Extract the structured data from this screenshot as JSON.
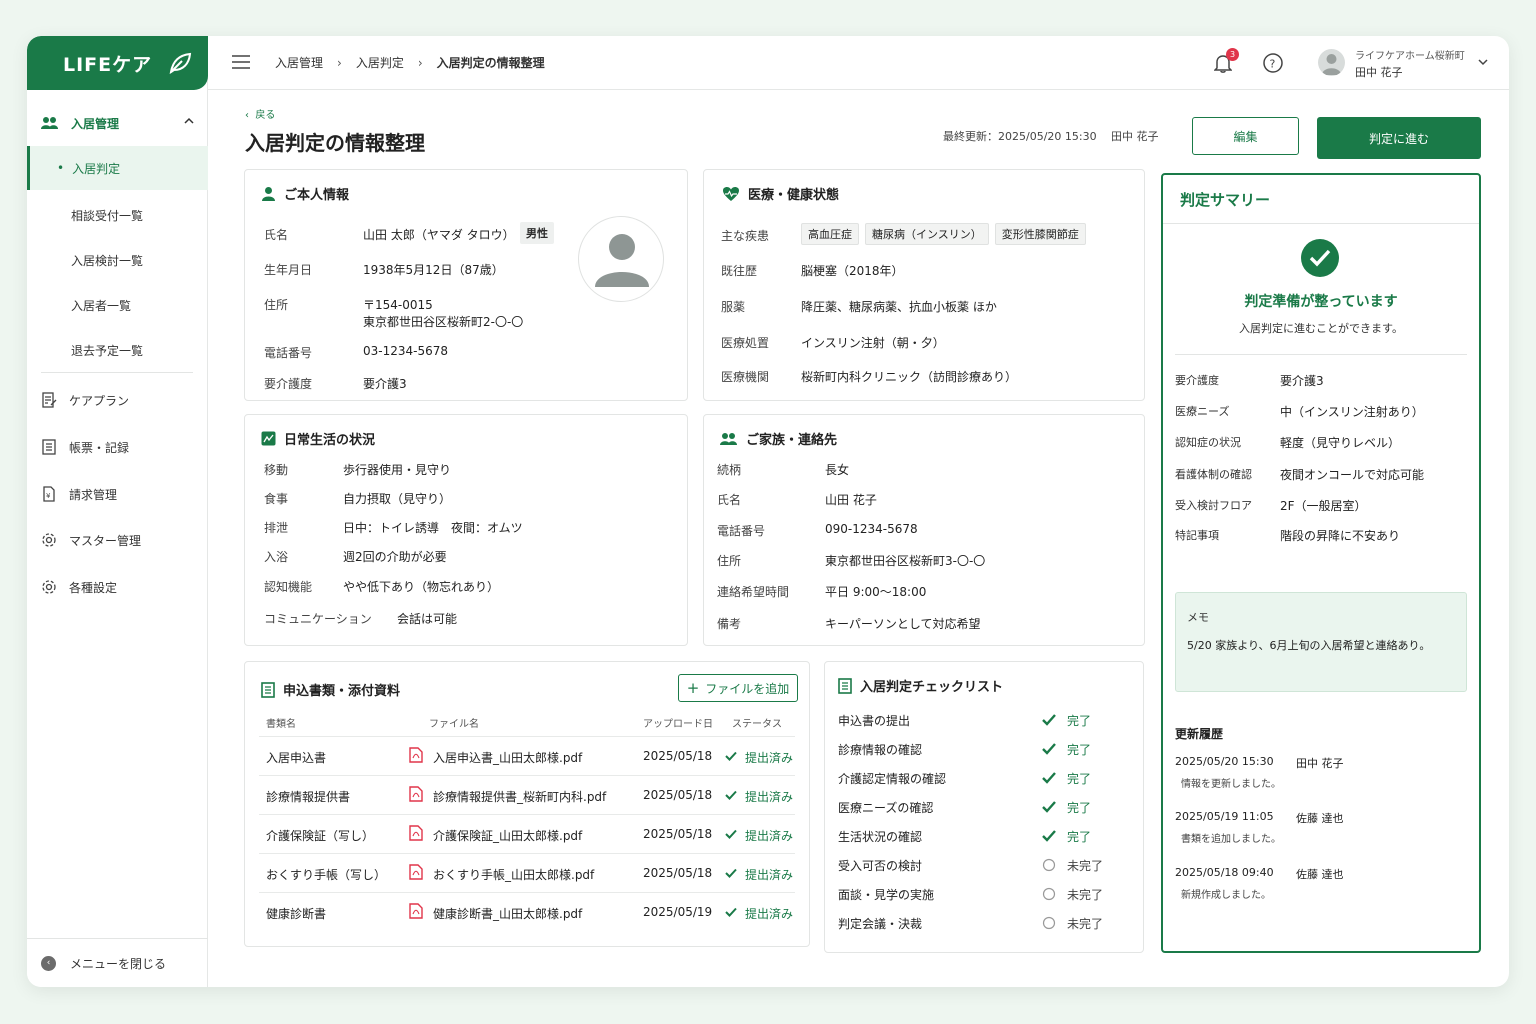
{
  "app": {
    "logo": "LIFEケア"
  },
  "sidebar": {
    "group": "入居管理",
    "active_item": "入居判定",
    "sub_items": [
      "相談受付一覧",
      "入居検討一覧",
      "入居者一覧",
      "退去予定一覧"
    ],
    "main_items": [
      {
        "label": "ケアプラン",
        "icon": "care-plan-icon"
      },
      {
        "label": "帳票・記録",
        "icon": "records-icon"
      },
      {
        "label": "請求管理",
        "icon": "billing-icon"
      },
      {
        "label": "マスター管理",
        "icon": "gear-icon"
      },
      {
        "label": "各種設定",
        "icon": "settings-icon"
      }
    ],
    "close_label": "メニューを閉じる"
  },
  "header": {
    "breadcrumbs": [
      "入居管理",
      "入居判定",
      "入居判定の情報整理"
    ],
    "notification_count": "3",
    "facility": "ライフケアホーム桜新町",
    "user": "田中 花子"
  },
  "page": {
    "back": "戻る",
    "title": "入居判定の情報整理",
    "last_updated": "最終更新：2025/05/20 15:30",
    "updated_by": "田中 花子",
    "edit_label": "編集",
    "next_label": "判定に進む"
  },
  "personal": {
    "title": "ご本人情報",
    "rows": [
      {
        "k": "氏名",
        "v": "山田 太郎（ヤマダ タロウ）"
      },
      {
        "k": "生年月日",
        "v": "1938年5月12日（87歳）"
      },
      {
        "k": "住所",
        "v": "〒154-0015",
        "v2": "東京都世田谷区桜新町2-〇-〇"
      },
      {
        "k": "電話番号",
        "v": "03-1234-5678"
      },
      {
        "k": "要介護度",
        "v": "要介護3"
      }
    ],
    "gender": "男性"
  },
  "medical": {
    "title": "医療・健康状態",
    "disease_label": "主な疾患",
    "diseases": [
      "高血圧症",
      "糖尿病（インスリン）",
      "変形性膝関節症"
    ],
    "rows": [
      {
        "k": "既往歴",
        "v": "脳梗塞（2018年）"
      },
      {
        "k": "服薬",
        "v": "降圧薬、糖尿病薬、抗血小板薬 ほか"
      },
      {
        "k": "医療処置",
        "v": "インスリン注射（朝・夕）"
      },
      {
        "k": "医療機関",
        "v": "桜新町内科クリニック（訪問診療あり）"
      }
    ]
  },
  "daily": {
    "title": "日常生活の状況",
    "rows": [
      {
        "k": "移動",
        "v": "歩行器使用・見守り"
      },
      {
        "k": "食事",
        "v": "自力摂取（見守り）"
      },
      {
        "k": "排泄",
        "v": "日中：トイレ誘導　夜間：オムツ"
      },
      {
        "k": "入浴",
        "v": "週2回の介助が必要"
      },
      {
        "k": "認知機能",
        "v": "やや低下あり（物忘れあり）"
      },
      {
        "k": "コミュニケーション",
        "v": "会話は可能"
      }
    ]
  },
  "family": {
    "title": "ご家族・連絡先",
    "rows": [
      {
        "k": "続柄",
        "v": "長女"
      },
      {
        "k": "氏名",
        "v": "山田 花子"
      },
      {
        "k": "電話番号",
        "v": "090-1234-5678"
      },
      {
        "k": "住所",
        "v": "東京都世田谷区桜新町3-〇-〇"
      },
      {
        "k": "連絡希望時間",
        "v": "平日 9:00〜18:00"
      },
      {
        "k": "備考",
        "v": "キーパーソンとして対応希望"
      }
    ]
  },
  "documents": {
    "title": "申込書類・添付資料",
    "add_label": "ファイルを追加",
    "headers": [
      "書類名",
      "ファイル名",
      "アップロード日",
      "ステータス"
    ],
    "rows": [
      {
        "name": "入居申込書",
        "file": "入居申込書_山田太郎様.pdf",
        "date": "2025/05/18",
        "status": "提出済み"
      },
      {
        "name": "診療情報提供書",
        "file": "診療情報提供書_桜新町内科.pdf",
        "date": "2025/05/18",
        "status": "提出済み"
      },
      {
        "name": "介護保険証（写し）",
        "file": "介護保険証_山田太郎様.pdf",
        "date": "2025/05/18",
        "status": "提出済み"
      },
      {
        "name": "おくすり手帳（写し）",
        "file": "おくすり手帳_山田太郎様.pdf",
        "date": "2025/05/18",
        "status": "提出済み"
      },
      {
        "name": "健康診断書",
        "file": "健康診断書_山田太郎様.pdf",
        "date": "2025/05/19",
        "status": "提出済み"
      }
    ]
  },
  "checklist": {
    "title": "入居判定チェックリスト",
    "items": [
      {
        "label": "申込書の提出",
        "status": "完了",
        "done": true
      },
      {
        "label": "診療情報の確認",
        "status": "完了",
        "done": true
      },
      {
        "label": "介護認定情報の確認",
        "status": "完了",
        "done": true
      },
      {
        "label": "医療ニーズの確認",
        "status": "完了",
        "done": true
      },
      {
        "label": "生活状況の確認",
        "status": "完了",
        "done": true
      },
      {
        "label": "受入可否の検討",
        "status": "未完了",
        "done": false
      },
      {
        "label": "面談・見学の実施",
        "status": "未完了",
        "done": false
      },
      {
        "label": "判定会議・決裁",
        "status": "未完了",
        "done": false
      }
    ]
  },
  "summary": {
    "title": "判定サマリー",
    "ready": "判定準備が整っています",
    "sub": "入居判定に進むことができます。",
    "rows": [
      {
        "k": "要介護度",
        "v": "要介護3"
      },
      {
        "k": "医療ニーズ",
        "v": "中（インスリン注射あり）"
      },
      {
        "k": "認知症の状況",
        "v": "軽度（見守りレベル）"
      },
      {
        "k": "看護体制の確認",
        "v": "夜間オンコールで対応可能"
      },
      {
        "k": "受入検討フロア",
        "v": "2F（一般居室）"
      },
      {
        "k": "特記事項",
        "v": "階段の昇降に不安あり"
      }
    ],
    "memo_label": "メモ",
    "memo_text": "5/20 家族より、6月上旬の入居希望と連絡あり。",
    "history_title": "更新履歴",
    "history": [
      {
        "date": "2025/05/20 15:30",
        "user": "田中 花子",
        "msg": "情報を更新しました。"
      },
      {
        "date": "2025/05/19 11:05",
        "user": "佐藤 達也",
        "msg": "書類を追加しました。"
      },
      {
        "date": "2025/05/18 09:40",
        "user": "佐藤 達也",
        "msg": "新規作成しました。"
      }
    ]
  },
  "colors": {
    "brand": "#1a7a48",
    "badge": "#e0354a",
    "pdf": "#e0354a"
  }
}
